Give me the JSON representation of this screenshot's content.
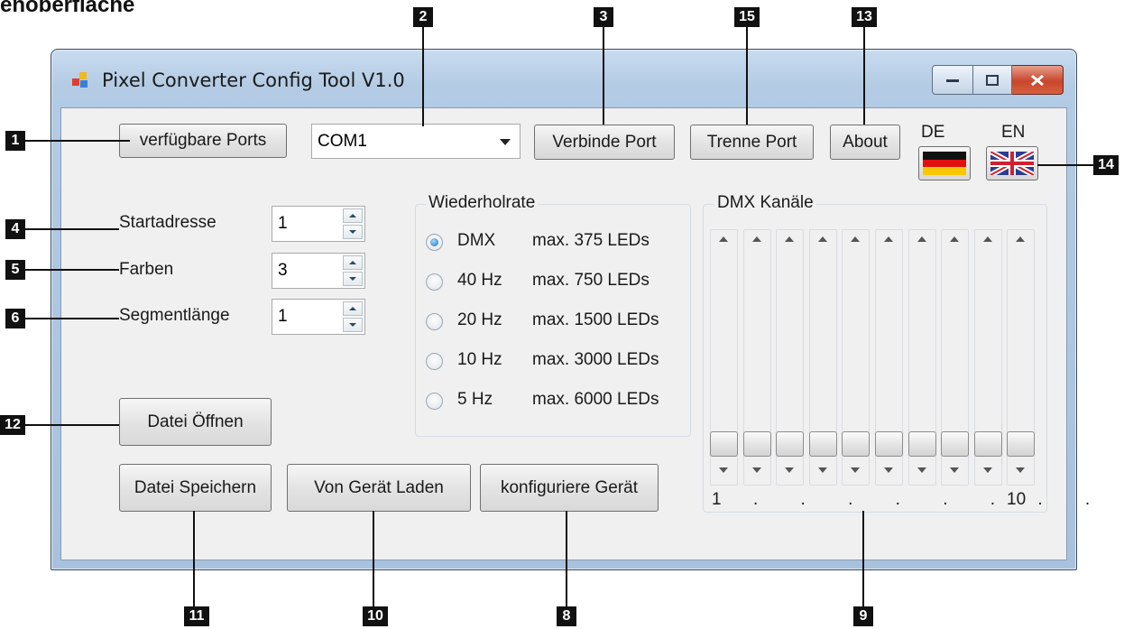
{
  "heading": "enoberfläche",
  "window": {
    "title": "Pixel Converter Config Tool V1.0"
  },
  "buttons": {
    "available_ports": "verfügbare Ports",
    "connect_port": "Verbinde Port",
    "disconnect_port": "Trenne Port",
    "about": "About",
    "open_file": "Datei Öffnen",
    "save_file": "Datei Speichern",
    "load_from_device": "Von Gerät Laden",
    "configure_device": "konfiguriere Gerät"
  },
  "port_select": {
    "value": "COM1"
  },
  "language": {
    "de": "DE",
    "en": "EN"
  },
  "settings": [
    {
      "label": "Startadresse",
      "value": "1"
    },
    {
      "label": "Farben",
      "value": "3"
    },
    {
      "label": "Segmentlänge",
      "value": "1"
    }
  ],
  "refresh": {
    "title": "Wiederholrate",
    "options": [
      {
        "rate": "DMX",
        "max": "max. 375 LEDs",
        "selected": true
      },
      {
        "rate": "40 Hz",
        "max": "max. 750 LEDs",
        "selected": false
      },
      {
        "rate": "20 Hz",
        "max": "max. 1500 LEDs",
        "selected": false
      },
      {
        "rate": "10 Hz",
        "max": "max. 3000 LEDs",
        "selected": false
      },
      {
        "rate": "5 Hz",
        "max": "max. 6000 LEDs",
        "selected": false
      }
    ]
  },
  "dmx": {
    "title": "DMX Kanäle",
    "first_label": "1",
    "last_label": "10",
    "channel_count": 10,
    "dots": ". . . . . . . ."
  },
  "callouts": [
    "1",
    "2",
    "3",
    "15",
    "13",
    "14",
    "4",
    "5",
    "6",
    "12",
    "11",
    "10",
    "8",
    "9"
  ]
}
